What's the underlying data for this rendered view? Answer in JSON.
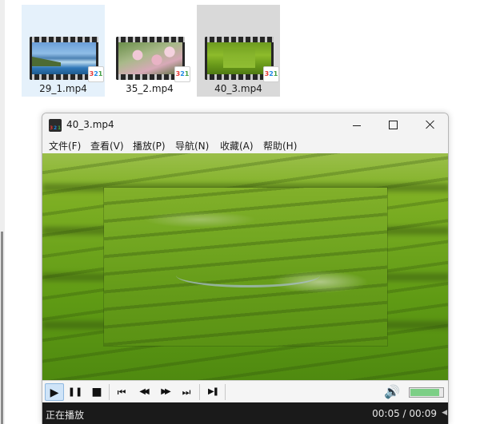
{
  "explorer": {
    "files": [
      {
        "name": "29_1.mp4",
        "state": "hover",
        "thumb": "coast"
      },
      {
        "name": "35_2.mp4",
        "state": "normal",
        "thumb": "blossom"
      },
      {
        "name": "40_3.mp4",
        "state": "selected",
        "thumb": "meadow"
      }
    ],
    "badge_digits": [
      "3",
      "2",
      "1"
    ]
  },
  "player": {
    "title": "40_3.mp4",
    "menu": [
      "文件(F)",
      "查看(V)",
      "播放(P)",
      "导航(N)",
      "收藏(A)",
      "帮助(H)"
    ],
    "controls": {
      "play": "▶",
      "pause": "❚❚",
      "stop": "■",
      "prev": "⏮",
      "rewind": "◀◀",
      "forward": "▶▶",
      "next": "⏭",
      "frame_step": "▶❚",
      "volume": "🔊"
    },
    "volume_level": 0.9,
    "status": "正在播放",
    "time": "00:05 / 00:09",
    "corner_glyph": "◀"
  },
  "colors": {
    "accent_hover": "#e5f1fb",
    "selected": "#d9d9d9",
    "status_bg": "#1a1a1a",
    "volume_green": "#7ccf86"
  }
}
